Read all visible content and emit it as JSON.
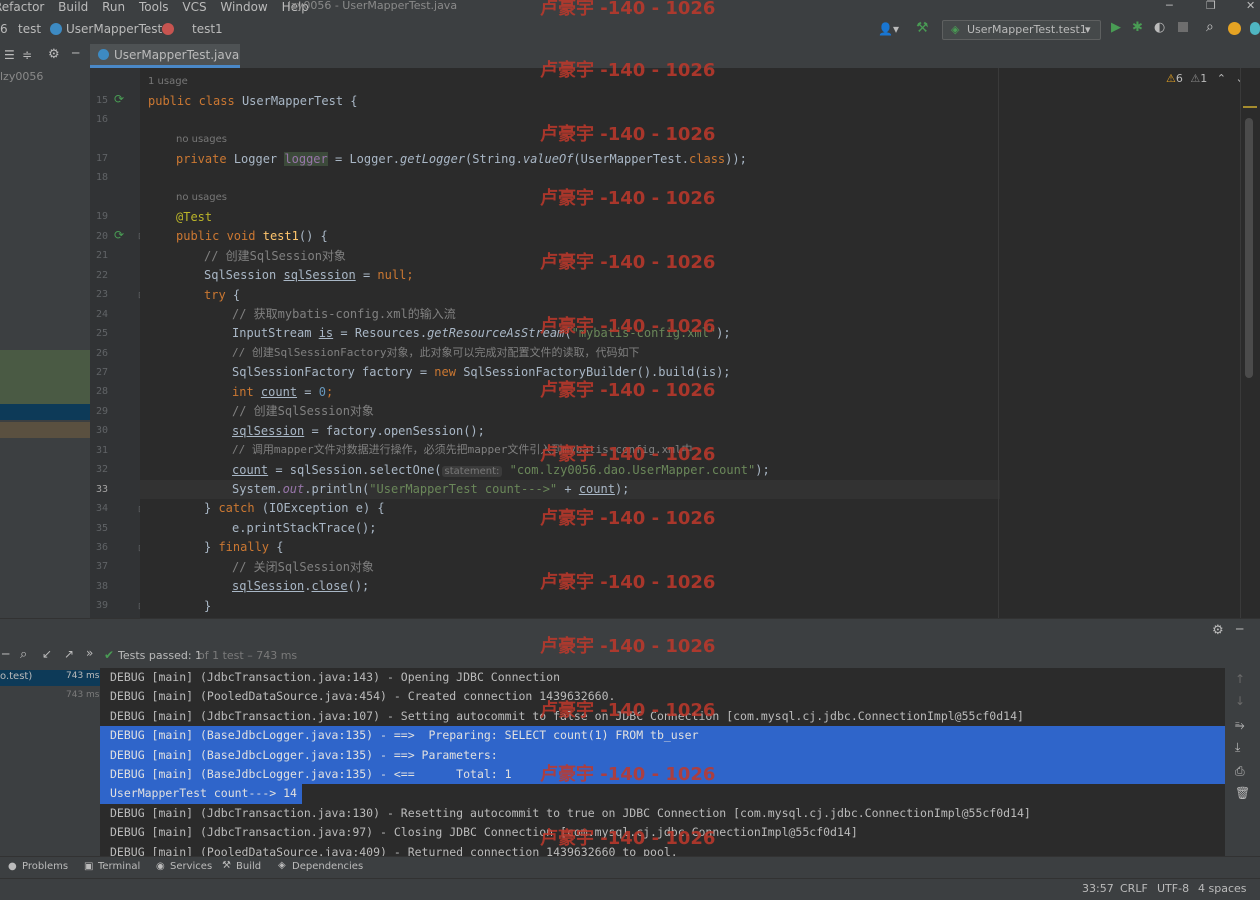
{
  "menu": [
    "Refactor",
    "Build",
    "Run",
    "Tools",
    "VCS",
    "Window",
    "Help"
  ],
  "window_title": "lzy0056 - UserMapperTest.java",
  "breadcrumbs": {
    "prefix": "6",
    "module": "test",
    "file": "UserMapperTest",
    "method": "test1"
  },
  "run_config": "UserMapperTest.test1",
  "editor_tab": "UserMapperTest.java",
  "project_label": "lzy0056",
  "inspections": {
    "warnings": "6",
    "weak_warnings": "1"
  },
  "usage_hints": {
    "class": "1 usage",
    "logger": "no usages",
    "test": "no usages"
  },
  "inlay_hint": "statement:",
  "code": {
    "l15": {
      "kw": "public class",
      "name": "UserMapperTest {"
    },
    "l17": {
      "kw": "private",
      "type": "Logger",
      "field": "logger",
      "rest1": " = Logger.",
      "call": "getLogger",
      "rest2": "(String.",
      "call2": "valueOf",
      "rest3": "(UserMapperTest.",
      "kw2": "class",
      "rest4": "));"
    },
    "l19": "@Test",
    "l20": {
      "kw": "public void",
      "name": "test1",
      "rest": "() {"
    },
    "l21": "// 创建SqlSession对象",
    "l22": {
      "type": "SqlSession",
      "var": "sqlSession",
      "rest": " = ",
      "kw": "null",
      "end": ";"
    },
    "l23": {
      "kw": "try",
      "rest": " {"
    },
    "l24": "// 获取mybatis-config.xml的输入流",
    "l25": {
      "a": "InputStream ",
      "var": "is",
      "b": " = Resources.",
      "call": "getResourceAsStream",
      "c": "(",
      "str": "\"mybatis-config.xml\"",
      "d": ");"
    },
    "l26": "// 创建SqlSessionFactory对象，此对象可以完成对配置文件的读取，代码如下",
    "l27": {
      "a": "SqlSessionFactory factory = ",
      "kw": "new",
      "b": " SqlSessionFactoryBuilder().build(is);"
    },
    "l28": {
      "kw": "int",
      "var": "count",
      "b": " = ",
      "num": "0",
      "c": ";"
    },
    "l29": "// 创建SqlSession对象",
    "l30": {
      "var": "sqlSession",
      "b": " = factory.openSession();"
    },
    "l31": "// 调用mapper文件对数据进行操作，必须先把mapper文件引入到mybatis-config.xml中",
    "l32": {
      "var": "count",
      "b": " = sqlSession.selectOne(",
      "str": "\"com.lzy0056.dao.UserMapper.count\"",
      "c": ");"
    },
    "l33": {
      "a": "System.",
      "fld": "out",
      "b": ".println(",
      "str": "\"UserMapperTest count--->\"",
      "c": " + ",
      "var": "count",
      "d": ");"
    },
    "l34": {
      "a": "} ",
      "kw": "catch",
      "b": " (IOException e) {"
    },
    "l35": "e.printStackTrace();",
    "l36": {
      "a": "} ",
      "kw": "finally",
      "b": " {"
    },
    "l37": "// 关闭SqlSession对象",
    "l38": {
      "var": "sqlSession",
      "b": ".",
      "call": "close",
      "c": "();"
    },
    "l39": "}"
  },
  "line_numbers": [
    "15",
    "16",
    "17",
    "18",
    "19",
    "20",
    "21",
    "22",
    "23",
    "24",
    "25",
    "26",
    "27",
    "28",
    "29",
    "30",
    "31",
    "32",
    "33",
    "34",
    "35",
    "36",
    "37",
    "38",
    "39"
  ],
  "run_panel": {
    "tests_passed": "Tests passed: 1",
    "tests_detail": "of 1 test – 743 ms",
    "tree_item": "o.test)",
    "tree_time1": "743 ms",
    "tree_time2": "743 ms"
  },
  "console": [
    "DEBUG [main] (JdbcTransaction.java:143) - Opening JDBC Connection",
    "DEBUG [main] (PooledDataSource.java:454) - Created connection 1439632660.",
    "DEBUG [main] (JdbcTransaction.java:107) - Setting autocommit to false on JDBC Connection [com.mysql.cj.jdbc.ConnectionImpl@55cf0d14]",
    "DEBUG [main] (BaseJdbcLogger.java:135) - ==>  Preparing: SELECT count(1) FROM tb_user",
    "DEBUG [main] (BaseJdbcLogger.java:135) - ==> Parameters: ",
    "DEBUG [main] (BaseJdbcLogger.java:135) - <==      Total: 1",
    "UserMapperTest count---> 14",
    "DEBUG [main] (JdbcTransaction.java:130) - Resetting autocommit to true on JDBC Connection [com.mysql.cj.jdbc.ConnectionImpl@55cf0d14]",
    "DEBUG [main] (JdbcTransaction.java:97) - Closing JDBC Connection [com.mysql.cj.jdbc.ConnectionImpl@55cf0d14]",
    "DEBUG [main] (PooledDataSource.java:409) - Returned connection 1439632660 to pool."
  ],
  "tool_windows": [
    "Problems",
    "Terminal",
    "Services",
    "Build",
    "Dependencies"
  ],
  "status": {
    "position": "33:57",
    "line_sep": "CRLF",
    "encoding": "UTF-8",
    "indent": "4 spaces"
  },
  "watermark": "卢豪宇 -140 - 1026",
  "colors": {
    "accent": "#4a88c7",
    "selection": "#2f65ca",
    "run_green": "#499c54"
  }
}
